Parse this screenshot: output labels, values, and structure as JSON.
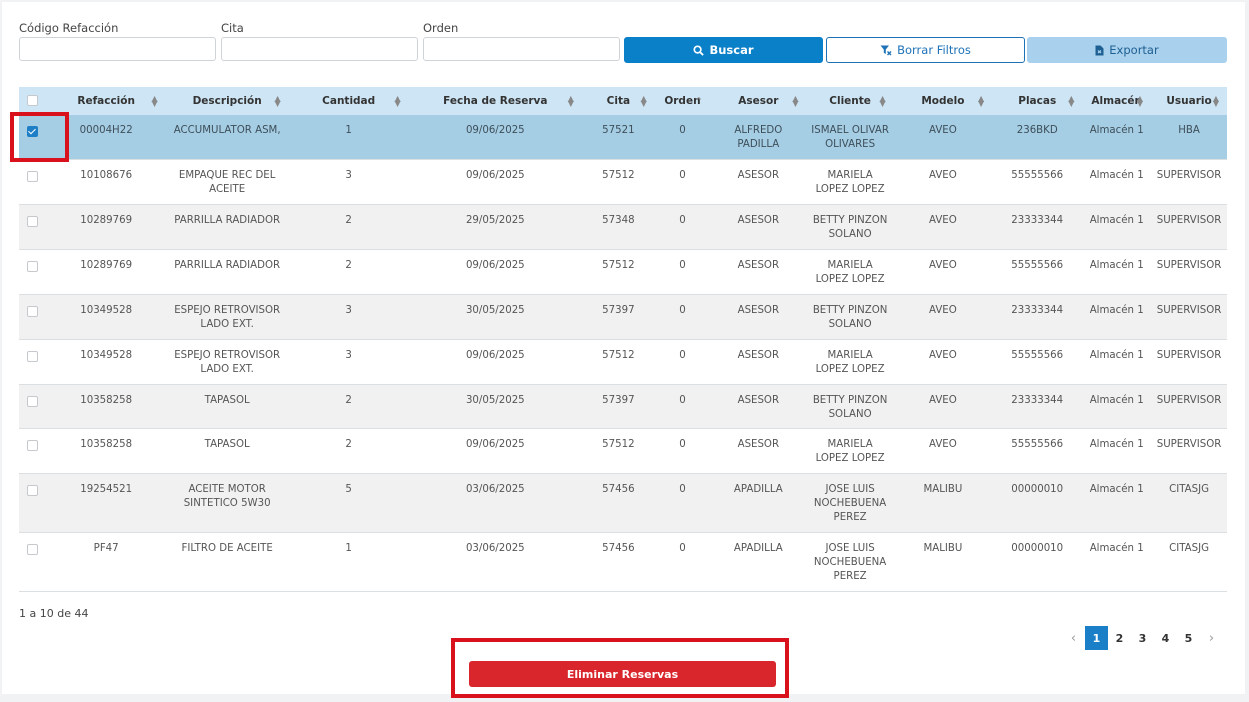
{
  "filters": {
    "codigo_label": "Código Refacción",
    "cita_label": "Cita",
    "orden_label": "Orden",
    "codigo_value": "",
    "cita_value": "",
    "orden_value": ""
  },
  "buttons": {
    "buscar": "Buscar",
    "borrar": "Borrar Filtros",
    "exportar": "Exportar",
    "eliminar": "Eliminar Reservas"
  },
  "table": {
    "headers": [
      "Refacción",
      "Descripción",
      "Cantidad",
      "Fecha de Reserva",
      "Cita",
      "Orden",
      "Asesor",
      "Cliente",
      "Modelo",
      "Placas",
      "Almacén",
      "Usuario"
    ],
    "rows": [
      {
        "checked": true,
        "cells": [
          "00004H22",
          "ACCUMULATOR ASM,",
          "1",
          "09/06/2025",
          "57521",
          "0",
          "ALFREDO PADILLA",
          "ISMAEL OLIVAR OLIVARES",
          "AVEO",
          "236BKD",
          "Almacén 1",
          "HBA"
        ]
      },
      {
        "checked": false,
        "cells": [
          "10108676",
          "EMPAQUE REC DEL ACEITE",
          "3",
          "09/06/2025",
          "57512",
          "0",
          "ASESOR",
          "MARIELA LOPEZ LOPEZ",
          "AVEO",
          "55555566",
          "Almacén 1",
          "SUPERVISOR"
        ]
      },
      {
        "checked": false,
        "cells": [
          "10289769",
          "PARRILLA RADIADOR",
          "2",
          "29/05/2025",
          "57348",
          "0",
          "ASESOR",
          "BETTY PINZON SOLANO",
          "AVEO",
          "23333344",
          "Almacén 1",
          "SUPERVISOR"
        ]
      },
      {
        "checked": false,
        "cells": [
          "10289769",
          "PARRILLA RADIADOR",
          "2",
          "09/06/2025",
          "57512",
          "0",
          "ASESOR",
          "MARIELA LOPEZ LOPEZ",
          "AVEO",
          "55555566",
          "Almacén 1",
          "SUPERVISOR"
        ]
      },
      {
        "checked": false,
        "cells": [
          "10349528",
          "ESPEJO RETROVISOR LADO EXT.",
          "3",
          "30/05/2025",
          "57397",
          "0",
          "ASESOR",
          "BETTY PINZON SOLANO",
          "AVEO",
          "23333344",
          "Almacén 1",
          "SUPERVISOR"
        ]
      },
      {
        "checked": false,
        "cells": [
          "10349528",
          "ESPEJO RETROVISOR LADO EXT.",
          "3",
          "09/06/2025",
          "57512",
          "0",
          "ASESOR",
          "MARIELA LOPEZ LOPEZ",
          "AVEO",
          "55555566",
          "Almacén 1",
          "SUPERVISOR"
        ]
      },
      {
        "checked": false,
        "cells": [
          "10358258",
          "TAPASOL",
          "2",
          "30/05/2025",
          "57397",
          "0",
          "ASESOR",
          "BETTY PINZON SOLANO",
          "AVEO",
          "23333344",
          "Almacén 1",
          "SUPERVISOR"
        ]
      },
      {
        "checked": false,
        "cells": [
          "10358258",
          "TAPASOL",
          "2",
          "09/06/2025",
          "57512",
          "0",
          "ASESOR",
          "MARIELA LOPEZ LOPEZ",
          "AVEO",
          "55555566",
          "Almacén 1",
          "SUPERVISOR"
        ]
      },
      {
        "checked": false,
        "cells": [
          "19254521",
          "ACEITE MOTOR SINTETICO 5W30",
          "5",
          "03/06/2025",
          "57456",
          "0",
          "APADILLA",
          "JOSE LUIS NOCHEBUENA PEREZ",
          "MALIBU",
          "00000010",
          "Almacén 1",
          "CITASJG"
        ]
      },
      {
        "checked": false,
        "cells": [
          "PF47",
          "FILTRO DE ACEITE",
          "1",
          "03/06/2025",
          "57456",
          "0",
          "APADILLA",
          "JOSE LUIS NOCHEBUENA PEREZ",
          "MALIBU",
          "00000010",
          "Almacén 1",
          "CITASJG"
        ]
      }
    ]
  },
  "pagination": {
    "info": "1 a 10 de 44",
    "pages": [
      "1",
      "2",
      "3",
      "4",
      "5"
    ],
    "active_page": "1",
    "prev": "‹",
    "next": "›"
  },
  "colors": {
    "primary": "#0a80c8",
    "header_bg": "#cde5f4",
    "selected_row": "#a5cde3",
    "danger": "#d8262c",
    "highlight_box": "#d8111c"
  }
}
